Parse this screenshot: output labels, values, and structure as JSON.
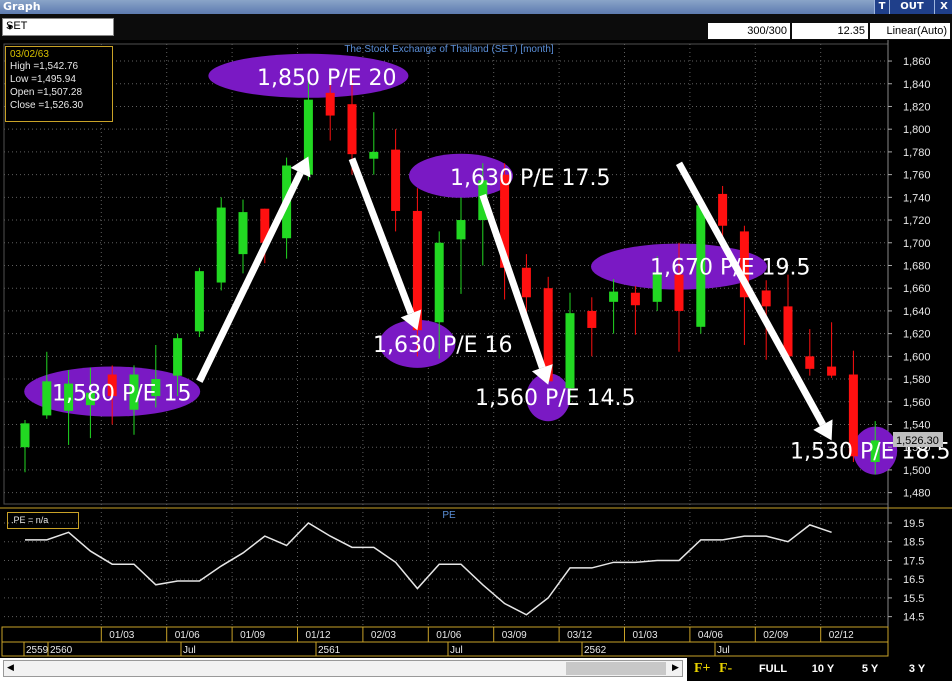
{
  "window": {
    "title": "Graph",
    "btn_t": "T",
    "btn_out": "OUT",
    "btn_x": "X",
    "symbol": "SET",
    "count": "300/300",
    "value": "12.35",
    "scale": "Linear(Auto)"
  },
  "info": {
    "date": "03/02/63",
    "high": "High  =1,542.76",
    "low": "Low   =1,495.94",
    "open": "Open  =1,507.28",
    "close": "Close =1,526.30"
  },
  "pe_legend": ".PE   = n/a",
  "buttons": {
    "f_plus": "F+",
    "f_minus": "F-",
    "full": "FULL",
    "y10": "10 Y",
    "y5": "5 Y",
    "y3": "3 Y"
  },
  "colors": {
    "up": "#22d822",
    "down": "#ff1010",
    "grid": "#5f5f5f",
    "ellipse": "#7a19c4",
    "pe_line": "#e6e6e6",
    "title": "#5b8fd8"
  },
  "chart_data": [
    {
      "type": "candlestick",
      "title": "The Stock Exchange of Thailand (SET) [month]",
      "ylim": [
        1470,
        1875
      ],
      "yticks": [
        1480,
        1500,
        1520,
        1540,
        1560,
        1580,
        1600,
        1620,
        1640,
        1660,
        1680,
        1700,
        1720,
        1740,
        1760,
        1780,
        1800,
        1820,
        1840,
        1860
      ],
      "ytick_labels": [
        "1,480",
        "1,500",
        "1,520",
        "1,540",
        "1,560",
        "1,580",
        "1,600",
        "1,620",
        "1,640",
        "1,660",
        "1,680",
        "1,700",
        "1,720",
        "1,740",
        "1,760",
        "1,780",
        "1,800",
        "1,820",
        "1,840",
        "1,860"
      ],
      "x_labels_row1": [
        "01/03",
        "01/06",
        "01/09",
        "01/12",
        "02/03",
        "01/06",
        "03/09",
        "03/12",
        "01/03",
        "04/06",
        "02/09",
        "02/12"
      ],
      "x_labels_row2": [
        "2559",
        "2560",
        "Jul",
        "2561",
        "Jul",
        "2562",
        "Jul"
      ],
      "last_value_label": "1,526.30",
      "candles": [
        {
          "o": 1520,
          "h": 1544,
          "l": 1498,
          "c": 1541
        },
        {
          "o": 1548,
          "h": 1604,
          "l": 1545,
          "c": 1578
        },
        {
          "o": 1552,
          "h": 1588,
          "l": 1522,
          "c": 1576
        },
        {
          "o": 1557,
          "h": 1590,
          "l": 1528,
          "c": 1568
        },
        {
          "o": 1584,
          "h": 1592,
          "l": 1540,
          "c": 1565
        },
        {
          "o": 1553,
          "h": 1592,
          "l": 1531,
          "c": 1584
        },
        {
          "o": 1565,
          "h": 1610,
          "l": 1555,
          "c": 1580
        },
        {
          "o": 1583,
          "h": 1620,
          "l": 1565,
          "c": 1616
        },
        {
          "o": 1622,
          "h": 1678,
          "l": 1617,
          "c": 1675
        },
        {
          "o": 1665,
          "h": 1740,
          "l": 1658,
          "c": 1731
        },
        {
          "o": 1690,
          "h": 1738,
          "l": 1673,
          "c": 1727
        },
        {
          "o": 1730,
          "h": 1730,
          "l": 1682,
          "c": 1700
        },
        {
          "o": 1704,
          "h": 1775,
          "l": 1686,
          "c": 1768
        },
        {
          "o": 1760,
          "h": 1842,
          "l": 1755,
          "c": 1826
        },
        {
          "o": 1832,
          "h": 1852,
          "l": 1790,
          "c": 1812
        },
        {
          "o": 1822,
          "h": 1843,
          "l": 1760,
          "c": 1778
        },
        {
          "o": 1774,
          "h": 1815,
          "l": 1760,
          "c": 1780
        },
        {
          "o": 1782,
          "h": 1800,
          "l": 1710,
          "c": 1728
        },
        {
          "o": 1728,
          "h": 1748,
          "l": 1600,
          "c": 1623
        },
        {
          "o": 1630,
          "h": 1710,
          "l": 1598,
          "c": 1700
        },
        {
          "o": 1703,
          "h": 1740,
          "l": 1655,
          "c": 1720
        },
        {
          "o": 1720,
          "h": 1770,
          "l": 1680,
          "c": 1755
        },
        {
          "o": 1760,
          "h": 1770,
          "l": 1650,
          "c": 1678
        },
        {
          "o": 1678,
          "h": 1690,
          "l": 1625,
          "c": 1652
        },
        {
          "o": 1660,
          "h": 1670,
          "l": 1582,
          "c": 1578
        },
        {
          "o": 1572,
          "h": 1656,
          "l": 1560,
          "c": 1638
        },
        {
          "o": 1640,
          "h": 1652,
          "l": 1600,
          "c": 1625
        },
        {
          "o": 1648,
          "h": 1668,
          "l": 1620,
          "c": 1657
        },
        {
          "o": 1656,
          "h": 1662,
          "l": 1619,
          "c": 1645
        },
        {
          "o": 1648,
          "h": 1688,
          "l": 1640,
          "c": 1674
        },
        {
          "o": 1672,
          "h": 1700,
          "l": 1604,
          "c": 1640
        },
        {
          "o": 1626,
          "h": 1740,
          "l": 1620,
          "c": 1733
        },
        {
          "o": 1743,
          "h": 1750,
          "l": 1700,
          "c": 1715
        },
        {
          "o": 1710,
          "h": 1715,
          "l": 1610,
          "c": 1652
        },
        {
          "o": 1658,
          "h": 1667,
          "l": 1597,
          "c": 1644
        },
        {
          "o": 1644,
          "h": 1672,
          "l": 1600,
          "c": 1600
        },
        {
          "o": 1600,
          "h": 1624,
          "l": 1583,
          "c": 1589
        },
        {
          "o": 1591,
          "h": 1630,
          "l": 1581,
          "c": 1583
        },
        {
          "o": 1584,
          "h": 1605,
          "l": 1507,
          "c": 1512
        },
        {
          "o": 1507,
          "h": 1543,
          "l": 1496,
          "c": 1526
        }
      ],
      "annotations": [
        {
          "text": "1,580 P/E 15",
          "at_candle": 4,
          "at_value": 1569
        },
        {
          "text": "1,850 P/E 20",
          "at_candle": 13,
          "at_value": 1847
        },
        {
          "text": "1,630 P/E 16",
          "at_candle": 18,
          "at_value": 1611
        },
        {
          "text": "1,630 P/E 17.5",
          "at_candle": 20,
          "at_value": 1759
        },
        {
          "text": "1,560 P/E 14.5",
          "at_candle": 24,
          "at_value": 1564
        },
        {
          "text": "1,670 P/E 19.5",
          "at_candle": 30,
          "at_value": 1679
        },
        {
          "text": "1,530 P/E 18.5",
          "at_candle": 39,
          "at_value": 1517
        }
      ],
      "arrows": [
        {
          "from": [
            8,
            1578
          ],
          "to": [
            13,
            1776
          ]
        },
        {
          "from": [
            15,
            1774
          ],
          "to": [
            18,
            1623
          ]
        },
        {
          "from": [
            21,
            1742
          ],
          "to": [
            24,
            1575
          ]
        },
        {
          "from": [
            30,
            1770
          ],
          "to": [
            37,
            1526
          ]
        }
      ]
    },
    {
      "type": "line",
      "title": "PE",
      "ylim": [
        14,
        20.3
      ],
      "yticks": [
        14.5,
        15.5,
        16.5,
        17.5,
        18.5,
        19.5
      ],
      "values": [
        18.6,
        18.6,
        19.0,
        18.0,
        17.3,
        17.3,
        16.2,
        16.4,
        16.4,
        17.2,
        17.9,
        18.8,
        18.3,
        19.5,
        18.8,
        18.2,
        18.2,
        17.4,
        16.0,
        17.3,
        17.3,
        16.2,
        15.2,
        14.6,
        15.5,
        17.1,
        17.1,
        17.4,
        17.4,
        17.5,
        17.5,
        18.6,
        18.6,
        18.8,
        18.8,
        18.5,
        19.4,
        19.0
      ]
    }
  ]
}
